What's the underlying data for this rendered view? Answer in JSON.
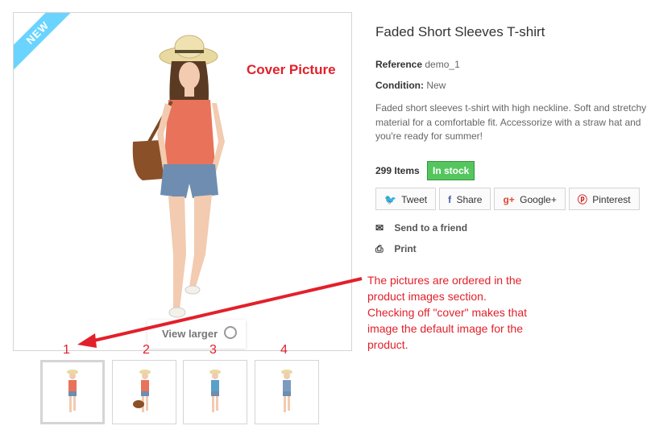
{
  "product": {
    "badge": "NEW",
    "title": "Faded Short Sleeves T-shirt",
    "reference_label": "Reference",
    "reference_value": "demo_1",
    "condition_label": "Condition:",
    "condition_value": "New",
    "description": "Faded short sleeves t-shirt with high neckline. Soft and stretchy material for a comfortable fit. Accessorize with a straw hat and you're ready for summer!",
    "quantity": "299 Items",
    "stock_status": "In stock",
    "view_larger": "View larger"
  },
  "social": {
    "tweet": "Tweet",
    "share": "Share",
    "googleplus": "Google+",
    "pinterest": "Pinterest"
  },
  "links": {
    "send_to_friend": "Send to a friend",
    "print": "Print"
  },
  "annotations": {
    "cover_label": "Cover Picture",
    "note": "The pictures are ordered in the product images section. Checking off \"cover\" makes that image the default image for the product.",
    "thumb_numbers": [
      "1",
      "2",
      "3",
      "4"
    ]
  },
  "colors": {
    "annotation_red": "#e2202a",
    "stock_green": "#55c65e",
    "ribbon_blue": "#6ad4ff",
    "shirt_coral": "#e8735a",
    "shirt_blue": "#5aa0c8"
  },
  "icons": {
    "tweet": "twitter-icon",
    "share": "facebook-icon",
    "googleplus": "google-plus-icon",
    "pinterest": "pinterest-icon",
    "send": "envelope-icon",
    "print": "printer-icon",
    "zoom": "zoom-in-icon"
  }
}
